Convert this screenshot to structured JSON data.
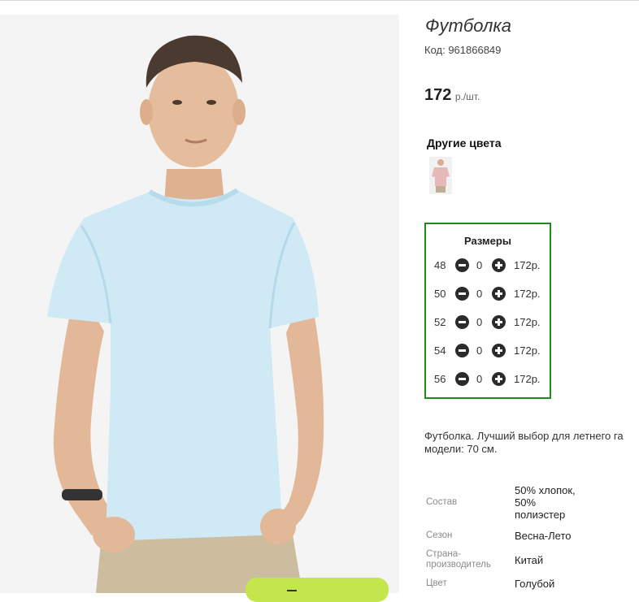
{
  "product": {
    "title": "Футболка",
    "sku": "Код: 961866849",
    "price_value": "172",
    "price_unit": "р./шт."
  },
  "other_colors": {
    "title": "Другие цвета",
    "swatches": [
      {
        "color": "#e6b9b8"
      }
    ]
  },
  "sizes": {
    "title": "Размеры",
    "rows": [
      {
        "size": "48",
        "qty": "0",
        "price": "172р."
      },
      {
        "size": "50",
        "qty": "0",
        "price": "172р."
      },
      {
        "size": "52",
        "qty": "0",
        "price": "172р."
      },
      {
        "size": "54",
        "qty": "0",
        "price": "172р."
      },
      {
        "size": "56",
        "qty": "0",
        "price": "172р."
      }
    ]
  },
  "description": {
    "line1": "Футболка. Лучший выбор для летнего га",
    "line2": "модели: 70 см."
  },
  "specs": [
    {
      "label": "Состав",
      "value_lines": [
        "50% хлопок,",
        "50%",
        "полиэстер"
      ]
    },
    {
      "label": "Сезон",
      "value_lines": [
        "Весна-Лето"
      ]
    },
    {
      "label": "Страна-производитель",
      "value_lines": [
        "Китай"
      ]
    },
    {
      "label": "Цвет",
      "value_lines": [
        "Голубой"
      ]
    }
  ],
  "colors": {
    "accent_border": "#1c8a1c",
    "shirt": "#cfeaf5",
    "cart_button": "#c2e64b"
  }
}
